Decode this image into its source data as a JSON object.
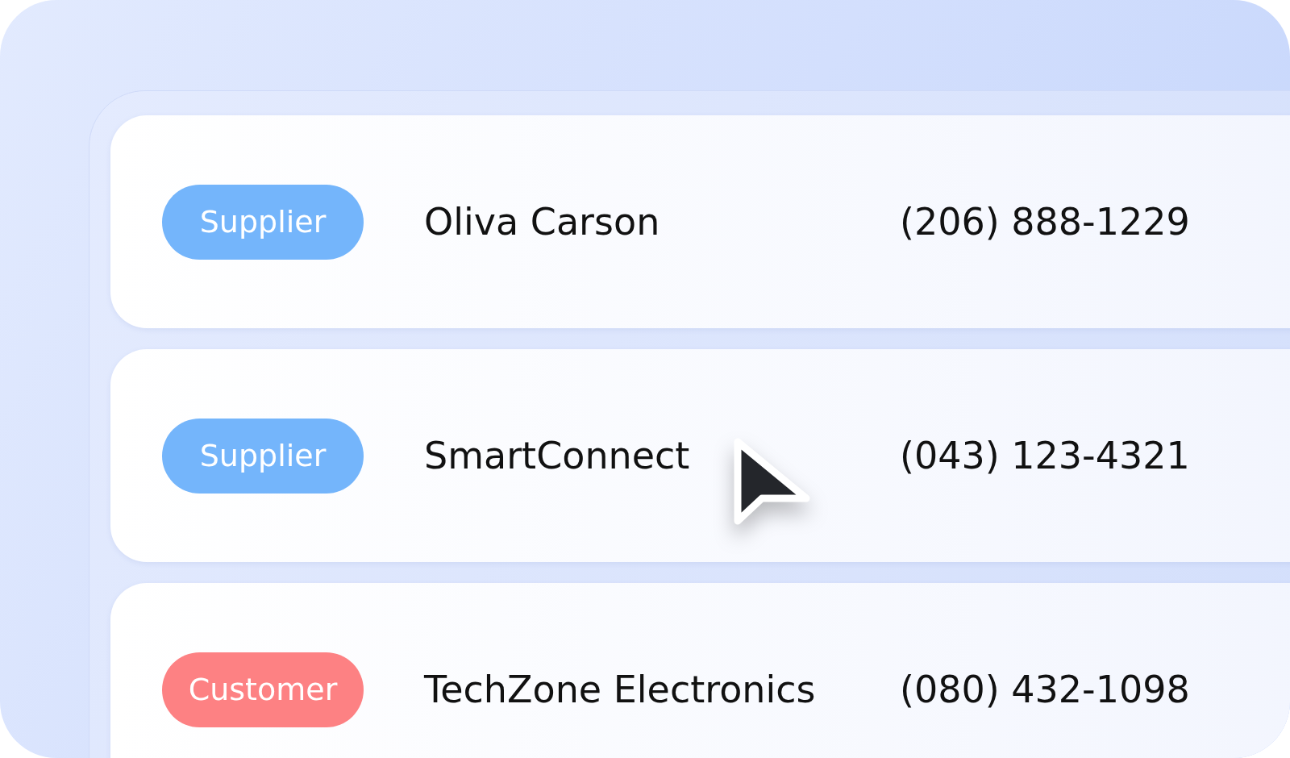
{
  "contacts": [
    {
      "type": "Supplier",
      "color": "#74b5fb",
      "name": "Oliva Carson",
      "phone": "(206) 888-1229"
    },
    {
      "type": "Supplier",
      "color": "#74b5fb",
      "name": "SmartConnect",
      "phone": "(043) 123-4321"
    },
    {
      "type": "Customer",
      "color": "#fd8183",
      "name": "TechZone Electronics",
      "phone": "(080) 432-1098"
    }
  ]
}
